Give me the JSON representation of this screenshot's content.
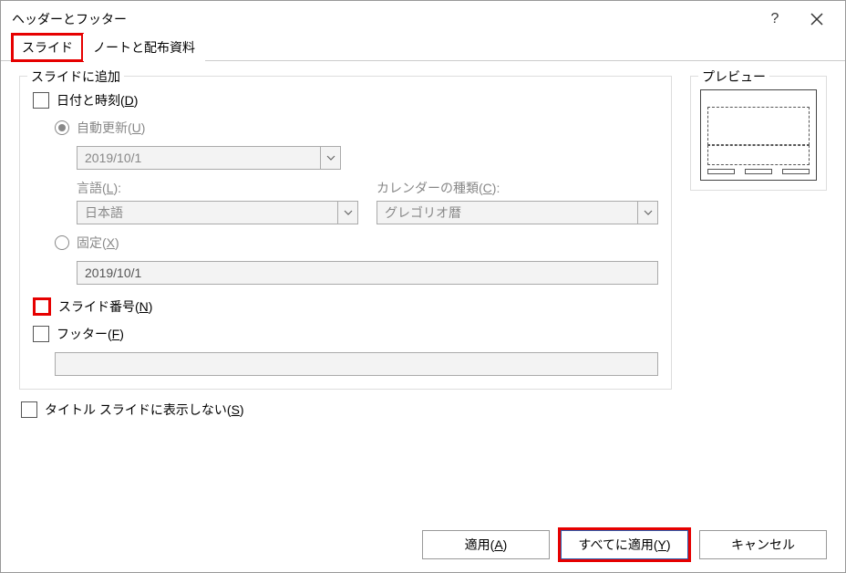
{
  "title": "ヘッダーとフッター",
  "tabs": {
    "slide": "スライド",
    "notes": "ノートと配布資料"
  },
  "group_label": "スライドに追加",
  "datetime": {
    "label_pre": "日付と時刻(",
    "accel": "D",
    "label_post": ")",
    "auto_pre": "自動更新(",
    "auto_accel": "U",
    "auto_post": ")",
    "date_value": "2019/10/1",
    "lang_label_pre": "言語(",
    "lang_accel": "L",
    "lang_label_post": "):",
    "lang_value": "日本語",
    "cal_label_pre": "カレンダーの種類(",
    "cal_accel": "C",
    "cal_label_post": "):",
    "cal_value": "グレゴリオ暦",
    "fixed_pre": "固定(",
    "fixed_accel": "X",
    "fixed_post": ")",
    "fixed_value": "2019/10/1"
  },
  "slide_number": {
    "label_pre": "スライド番号(",
    "accel": "N",
    "label_post": ")"
  },
  "footer": {
    "label_pre": "フッター(",
    "accel": "F",
    "label_post": ")",
    "value": ""
  },
  "no_title": {
    "label_pre": "タイトル スライドに表示しない(",
    "accel": "S",
    "label_post": ")"
  },
  "preview_label": "プレビュー",
  "buttons": {
    "apply_pre": "適用(",
    "apply_accel": "A",
    "apply_post": ")",
    "apply_all_pre": "すべてに適用(",
    "apply_all_accel": "Y",
    "apply_all_post": ")",
    "cancel": "キャンセル"
  }
}
